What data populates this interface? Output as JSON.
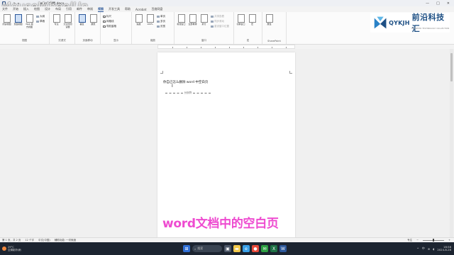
{
  "watermark": "MouseWheelUp",
  "titlebar": {
    "doc_title": "word 文档.docx",
    "qat": [
      "↶",
      "↷",
      "▾"
    ],
    "window_controls": [
      "—",
      "□",
      "✕"
    ]
  },
  "tabs": [
    "文件",
    "开始",
    "插入",
    "绘图",
    "设计",
    "布局",
    "引用",
    "邮件",
    "审阅",
    "视图",
    "开发工具",
    "帮助",
    "Acrobat",
    "百度网盘"
  ],
  "active_tab": "视图",
  "ribbon": {
    "groups": [
      {
        "label": "视图",
        "buttons": [
          "阅读视图",
          "页面视图",
          "Web 版式视图"
        ],
        "small": [
          "大纲",
          "草稿"
        ]
      },
      {
        "label": "沉浸式",
        "buttons": [
          "专注",
          "沉浸式阅读器"
        ]
      },
      {
        "label": "页面移动",
        "buttons": [
          "垂直",
          "翻页"
        ]
      },
      {
        "label": "显示",
        "checks": [
          "标尺",
          "网格线",
          "导航窗格"
        ]
      },
      {
        "label": "缩放",
        "buttons": [
          "缩放",
          "100%"
        ],
        "small": [
          "单页",
          "多页",
          "页宽"
        ]
      },
      {
        "label": "窗口",
        "buttons": [
          "新建窗口",
          "全部重排",
          "拆分"
        ],
        "small": [
          "并排查看",
          "同步滚动",
          "重设窗口位置"
        ]
      },
      {
        "label": "宏",
        "buttons": [
          "切换窗口",
          "宏"
        ]
      },
      {
        "label": "SharePoint",
        "buttons": [
          "属性"
        ]
      }
    ]
  },
  "logo": {
    "brand": "QYKJH",
    "cn": "前沿科技汇",
    "sub": "FRONTIER TECHNOLOGY COLLECTION"
  },
  "document": {
    "line1": "你自己怎么删除 word 中空白页",
    "page_break": "分页符"
  },
  "subtitle": "word文档中的空白页",
  "statusbar": {
    "left": [
      "第 1 页，共 2 页",
      "12 个字",
      "中文(中国)",
      "辅助功能: 一切就绪"
    ],
    "right": [
      "专注"
    ]
  },
  "taskbar": {
    "weather_temp": "29°C",
    "weather_desc": "空调制冷/雨",
    "search": "搜索",
    "time": "18:58",
    "date": "2024-8-28",
    "lang": "中"
  },
  "colors": {
    "subtitle": "#ee4bd0",
    "accent": "#2b579a",
    "taskbar": "#1c2430",
    "logo": "#1d4f84"
  }
}
